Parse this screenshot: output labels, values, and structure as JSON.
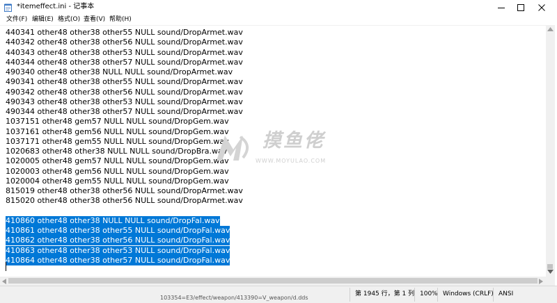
{
  "window": {
    "title": "*itemeffect.ini - 记事本",
    "controls": {
      "minimize": "minimize",
      "maximize": "maximize",
      "close": "close"
    }
  },
  "menu": [
    {
      "label": "文件(F)"
    },
    {
      "label": "编辑(E)"
    },
    {
      "label": "格式(O)"
    },
    {
      "label": "查看(V)"
    },
    {
      "label": "帮助(H)"
    }
  ],
  "editor": {
    "lines": [
      {
        "text": "440341 other48 other38 other55 NULL sound/DropArmet.wav",
        "selected": false
      },
      {
        "text": "440342 other48 other38 other56 NULL sound/DropArmet.wav",
        "selected": false
      },
      {
        "text": "440343 other48 other38 other53 NULL sound/DropArmet.wav",
        "selected": false
      },
      {
        "text": "440344 other48 other38 other57 NULL sound/DropArmet.wav",
        "selected": false
      },
      {
        "text": "490340 other48 other38 NULL NULL sound/DropArmet.wav",
        "selected": false
      },
      {
        "text": "490341 other48 other38 other55 NULL sound/DropArmet.wav",
        "selected": false
      },
      {
        "text": "490342 other48 other38 other56 NULL sound/DropArmet.wav",
        "selected": false
      },
      {
        "text": "490343 other48 other38 other53 NULL sound/DropArmet.wav",
        "selected": false
      },
      {
        "text": "490344 other48 other38 other57 NULL sound/DropArmet.wav",
        "selected": false
      },
      {
        "text": "1037151 other48 gem57 NULL NULL sound/DropGem.wav",
        "selected": false
      },
      {
        "text": "1037161 other48 gem56 NULL NULL sound/DropGem.wav",
        "selected": false
      },
      {
        "text": "1037171 other48 gem55 NULL NULL sound/DropGem.wav",
        "selected": false
      },
      {
        "text": "1020683 other48 other38 NULL NULL sound/DropBra.wav",
        "selected": false
      },
      {
        "text": "1020005 other48 gem57 NULL NULL sound/DropGem.wav",
        "selected": false
      },
      {
        "text": "1020003 other48 gem56 NULL NULL sound/DropGem.wav",
        "selected": false
      },
      {
        "text": "1020004 other48 gem55 NULL NULL sound/DropGem.wav",
        "selected": false
      },
      {
        "text": "815019 other48 other38 other56 NULL sound/DropArmet.wav",
        "selected": false
      },
      {
        "text": "815020 other48 other38 other56 NULL sound/DropArmet.wav",
        "selected": false
      },
      {
        "text": "",
        "selected": false
      },
      {
        "text": "410860 other48 other38 NULL NULL sound/DropFal.wav",
        "selected": true
      },
      {
        "text": "410861 other48 other38 other55 NULL sound/DropFal.wav",
        "selected": true
      },
      {
        "text": "410862 other48 other38 other56 NULL sound/DropFal.wav",
        "selected": true
      },
      {
        "text": "410863 other48 other38 other53 NULL sound/DropFal.wav",
        "selected": true
      },
      {
        "text": "410864 other48 other38 other57 NULL sound/DropFal.wav",
        "selected": true
      }
    ],
    "selection_color": "#0078d7"
  },
  "statusbar": {
    "position": "第 1945 行，第 1 列",
    "zoom": "100%",
    "line_ending": "Windows (CRLF)",
    "encoding": "ANSI"
  },
  "background_text": "103354=E3/effect/weapon/413390=V_weapon/d.dds",
  "watermark": {
    "cn": "摸鱼佬",
    "en": "WWW.MOYULAO.COM"
  }
}
